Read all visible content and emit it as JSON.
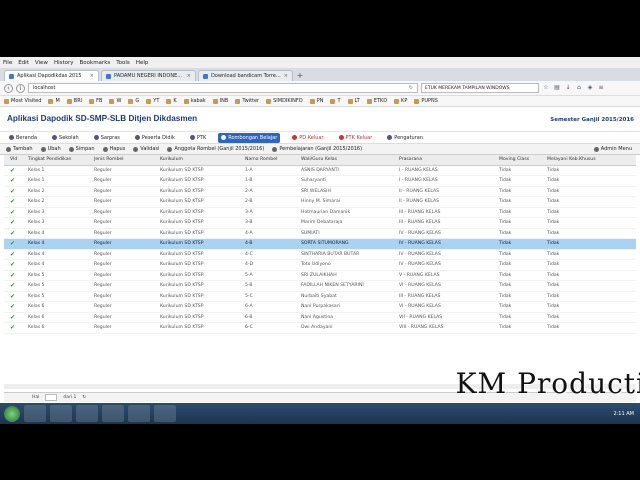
{
  "browser": {
    "menu": [
      "File",
      "Edit",
      "View",
      "History",
      "Bookmarks",
      "Tools",
      "Help"
    ],
    "tabs": [
      {
        "label": "Aplikasi Dapodikdas 2015",
        "active": true
      },
      {
        "label": "PADAMU NEGERI INDONE...",
        "active": false
      },
      {
        "label": "Download bandicam Torre...",
        "active": false
      }
    ],
    "url": "localhost",
    "search": "ETUK MEREKAM TAMPILAN WINDOWS",
    "bookmarks": [
      "Most Visited",
      "M",
      "BRI",
      "FB",
      "W",
      "G",
      "YT",
      "K",
      "kabak",
      "INB",
      "Twitter",
      "SIMDIKINFO",
      "PN",
      "T",
      "LT",
      "ETKD",
      "KP",
      "PUPNS"
    ]
  },
  "app": {
    "title": "Aplikasi Dapodik SD-SMP-SLB Ditjen Dikdasmen",
    "semester": "Semester Ganjil 2015/2016",
    "nav": [
      {
        "label": "Beranda",
        "active": false
      },
      {
        "label": "Sekolah",
        "active": false
      },
      {
        "label": "Sarpras",
        "active": false
      },
      {
        "label": "Peserta Didik",
        "active": false
      },
      {
        "label": "PTK",
        "active": false
      },
      {
        "label": "Rombongan Belajar",
        "active": true
      },
      {
        "label": "PD Keluar",
        "active": false,
        "red": true
      },
      {
        "label": "PTK Keluar",
        "active": false,
        "red": true
      },
      {
        "label": "Pengaturan",
        "active": false
      }
    ],
    "toolbar": [
      "Tambah",
      "Ubah",
      "Simpan",
      "Hapus",
      "Validasi",
      "Anggota Rombel (Ganjil 2015/2016)",
      "Pembelajaran (Ganjil 2015/2016)"
    ],
    "admin_menu": "Admin Menu"
  },
  "table": {
    "headers": [
      "Vld",
      "Tingkat Pendidikan",
      "Jenis Rombel",
      "Kurikulum",
      "Nama Rombel",
      "Wali/Guru Kelas",
      "Prasarana",
      "Moving Class",
      "Melayani Keb.Khusus"
    ],
    "rows": [
      [
        "✔",
        "Kelas 1",
        "Reguler",
        "Kurikulum SD KTSP",
        "1-A",
        "ASNIS DARYANTI",
        "I - RUANG KELAS",
        "Tidak",
        "Tidak"
      ],
      [
        "✔",
        "Kelas 1",
        "Reguler",
        "Kurikulum SD KTSP",
        "1-B",
        "Suharyanti",
        "I - RUANG KELAS",
        "Tidak",
        "Tidak"
      ],
      [
        "✔",
        "Kelas 2",
        "Reguler",
        "Kurikulum SD KTSP",
        "2-A",
        "SRI WELASIH",
        "II - RUANG KELAS",
        "Tidak",
        "Tidak"
      ],
      [
        "✔",
        "Kelas 2",
        "Reguler",
        "Kurikulum SD KTSP",
        "2-B",
        "Hinny M. Simarai",
        "II - RUANG KELAS",
        "Tidak",
        "Tidak"
      ],
      [
        "✔",
        "Kelas 3",
        "Reguler",
        "Kurikulum SD KTSP",
        "3-A",
        "Hotmaurian Damanik",
        "III - RUANG KELAS",
        "Tidak",
        "Tidak"
      ],
      [
        "✔",
        "Kelas 3",
        "Reguler",
        "Kurikulum SD KTSP",
        "3-B",
        "Marim Debataraja",
        "III - RUANG KELAS",
        "Tidak",
        "Tidak"
      ],
      [
        "✔",
        "Kelas 4",
        "Reguler",
        "Kurikulum SD KTSP",
        "4-A",
        "SUMIATI",
        "IV - RUANG KELAS",
        "Tidak",
        "Tidak"
      ],
      [
        "✔",
        "Kelas 4",
        "Reguler",
        "Kurikulum SD KTSP",
        "4-B",
        "SORTA SITUMORANG",
        "IV - RUANG KELAS",
        "Tidak",
        "Tidak"
      ],
      [
        "✔",
        "Kelas 4",
        "Reguler",
        "Kurikulum SD KTSP",
        "4-C",
        "SINTHARIA BUTAR BUTAR",
        "IV - RUANG KELAS",
        "Tidak",
        "Tidak"
      ],
      [
        "✔",
        "Kelas 4",
        "Reguler",
        "Kurikulum SD KTSP",
        "4-D",
        "Toto Udiyono",
        "IV - RUANG KELAS",
        "Tidak",
        "Tidak"
      ],
      [
        "✔",
        "Kelas 5",
        "Reguler",
        "Kurikulum SD KTSP",
        "5-A",
        "SRI ZULAIKHAH",
        "V - RUANG KELAS",
        "Tidak",
        "Tidak"
      ],
      [
        "✔",
        "Kelas 5",
        "Reguler",
        "Kurikulum SD KTSP",
        "5-B",
        "FADILLAH NIKEN SETYARINI",
        "VI - RUANG KELAS",
        "Tidak",
        "Tidak"
      ],
      [
        "✔",
        "Kelas 5",
        "Reguler",
        "Kurikulum SD KTSP",
        "5-C",
        "Nurbaiti Syabat",
        "III - RUANG KELAS",
        "Tidak",
        "Tidak"
      ],
      [
        "✔",
        "Kelas 6",
        "Reguler",
        "Kurikulum SD KTSP",
        "6-A",
        "Nani Purpakasari",
        "VI - RUANG KELAS",
        "Tidak",
        "Tidak"
      ],
      [
        "✔",
        "Kelas 6",
        "Reguler",
        "Kurikulum SD KTSP",
        "6-B",
        "Nani Agustina",
        "VII - RUANG KELAS",
        "Tidak",
        "Tidak"
      ],
      [
        "✔",
        "Kelas 6",
        "Reguler",
        "Kurikulum SD KTSP",
        "6-C",
        "Dwi Andayani",
        "VIII - RUANG KELAS",
        "Tidak",
        "Tidak"
      ]
    ],
    "selected_row": 7
  },
  "pager": {
    "prefix": "Hal",
    "page": "1",
    "suffix": "dari 1"
  },
  "watermark": "KM Producti",
  "taskbar": {
    "clock": "2:11 AM"
  }
}
